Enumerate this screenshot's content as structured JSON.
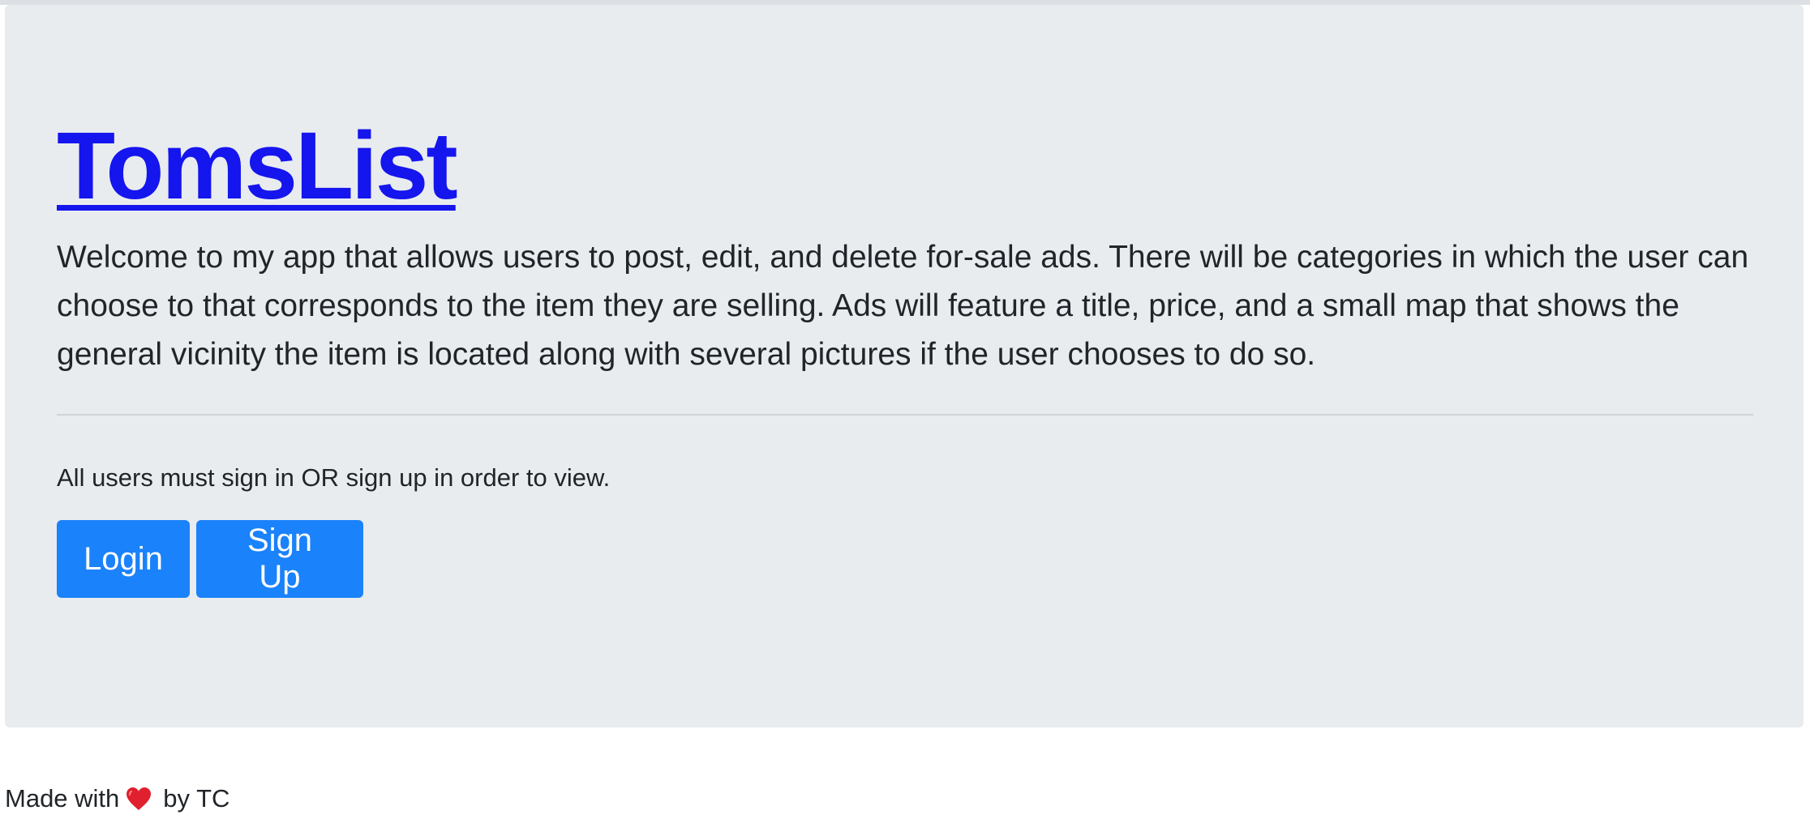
{
  "header": {
    "title": "TomsList"
  },
  "intro": {
    "description": "Welcome to my app that allows users to post, edit, and delete for-sale ads. There will be categories in which the user can choose to that corresponds to the item they are selling. Ads will feature a title, price, and a small map that shows the general vicinity the item is located along with several pictures if the user chooses to do so."
  },
  "auth": {
    "notice": "All users must sign in OR sign up in order to view.",
    "login_label": "Login",
    "signup_label": "Sign Up"
  },
  "footer": {
    "made_with": "Made with",
    "icon": "heart-icon",
    "by": "by TC"
  },
  "colors": {
    "primary": "#1a82fb",
    "link": "#1515ee",
    "jumbotron_bg": "#e9ecef",
    "heart": "#e0202e"
  }
}
